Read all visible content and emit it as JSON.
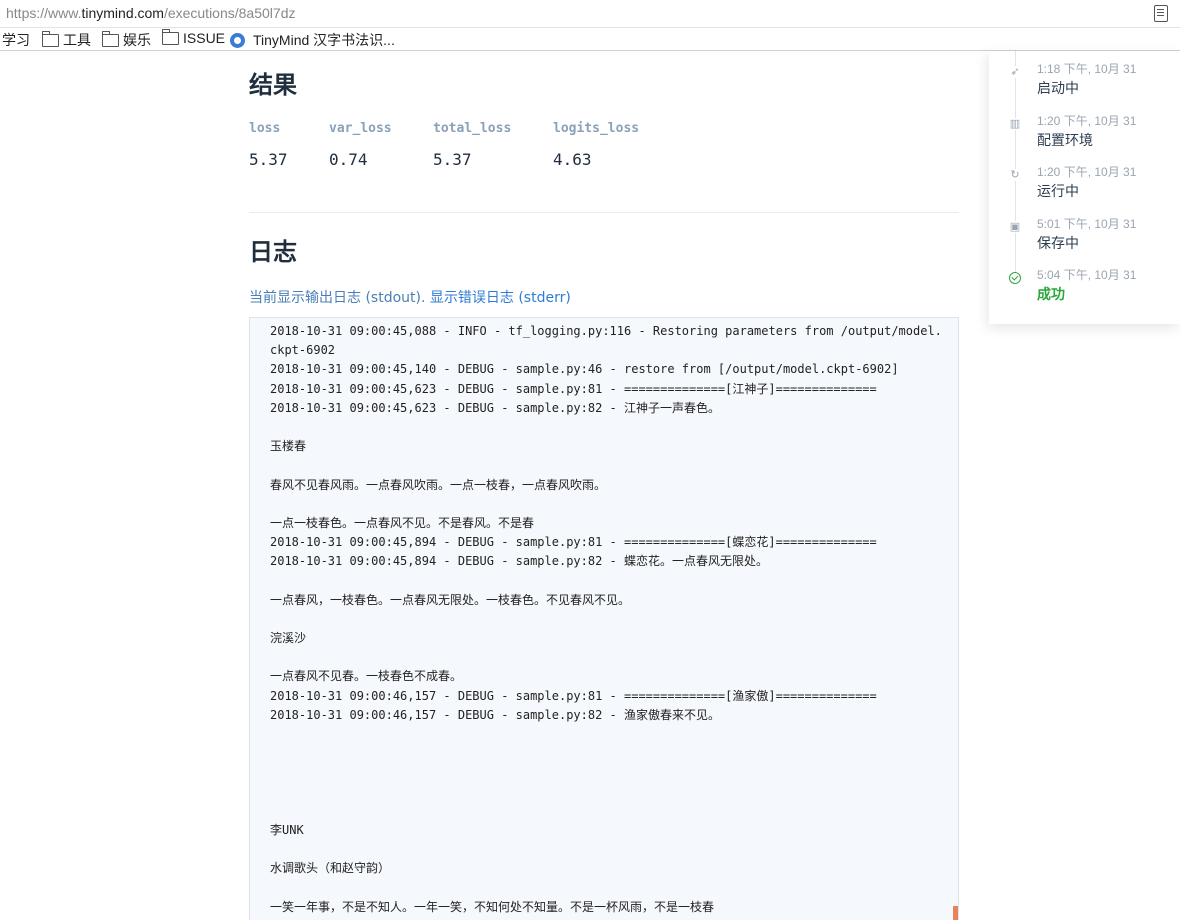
{
  "browser": {
    "url_scheme": "https://www.",
    "url_host": "tinymind.com",
    "url_path": "/executions/8a50l7dz",
    "bookmarks": [
      {
        "label": "学习",
        "icon": "none"
      },
      {
        "label": "工具",
        "icon": "folder-icon"
      },
      {
        "label": "娱乐",
        "icon": "folder-icon"
      },
      {
        "label": "ISSUE",
        "icon": "folder-icon"
      },
      {
        "label": "TinyMind 汉字书法识...",
        "icon": "tinymind-icon"
      }
    ]
  },
  "results": {
    "title": "结果",
    "metrics": [
      {
        "label": "loss",
        "value": "5.37"
      },
      {
        "label": "var_loss",
        "value": "0.74"
      },
      {
        "label": "total_loss",
        "value": "5.37"
      },
      {
        "label": "logits_loss",
        "value": "4.63"
      }
    ]
  },
  "logs": {
    "title": "日志",
    "current_text": "当前显示输出日志 (stdout). ",
    "switch_link": "显示错误日志 (stderr)",
    "lines": [
      "2018-10-31 09:00:45,088 - INFO - tf_logging.py:116 - Restoring parameters from /output/model.",
      "ckpt-6902",
      "2018-10-31 09:00:45,140 - DEBUG - sample.py:46 - restore from [/output/model.ckpt-6902]",
      "2018-10-31 09:00:45,623 - DEBUG - sample.py:81 - ==============[江神子]==============",
      "2018-10-31 09:00:45,623 - DEBUG - sample.py:82 - 江神子一声春色。",
      "",
      "玉楼春",
      "",
      "春风不见春风雨。一点春风吹雨。一点一枝春，一点春风吹雨。",
      "",
      "一点一枝春色。一点春风不见。不是春风。不是春",
      "2018-10-31 09:00:45,894 - DEBUG - sample.py:81 - ==============[蝶恋花]==============",
      "2018-10-31 09:00:45,894 - DEBUG - sample.py:82 - 蝶恋花。一点春风无限处。",
      "",
      "一点春风，一枝春色。一点春风无限处。一枝春色。不见春风不见。",
      "",
      "浣溪沙",
      "",
      "一点春风不见春。一枝春色不成春。",
      "2018-10-31 09:00:46,157 - DEBUG - sample.py:81 - ==============[渔家傲]==============",
      "2018-10-31 09:00:46,157 - DEBUG - sample.py:82 - 渔家傲春来不见。",
      "",
      "",
      "",
      "",
      "",
      "李UNK",
      "",
      "水调歌头（和赵守韵）",
      "",
      "一笑一年事，不是不知人。一年一笑，不知何处不知量。不是一杯风雨，不是一枝春"
    ]
  },
  "timeline": [
    {
      "time": "1:18 下午, 10月 31",
      "label": "启动中",
      "icon": "rocket-icon",
      "glyph": "➶"
    },
    {
      "time": "1:20 下午, 10月 31",
      "label": "配置环境",
      "icon": "factory-icon",
      "glyph": "▥"
    },
    {
      "time": "1:20 下午, 10月 31",
      "label": "运行中",
      "icon": "refresh-icon",
      "glyph": "↻"
    },
    {
      "time": "5:01 下午, 10月 31",
      "label": "保存中",
      "icon": "save-icon",
      "glyph": "▣"
    },
    {
      "time": "5:04 下午, 10月 31",
      "label": "成功",
      "icon": "check-circle-icon",
      "status": "success"
    }
  ],
  "colors": {
    "heading": "#1f2d3d",
    "metric_label": "#8aa0b8",
    "link": "#2f7bd6",
    "success": "#2aa63a",
    "log_bg": "#f5f8fc"
  }
}
